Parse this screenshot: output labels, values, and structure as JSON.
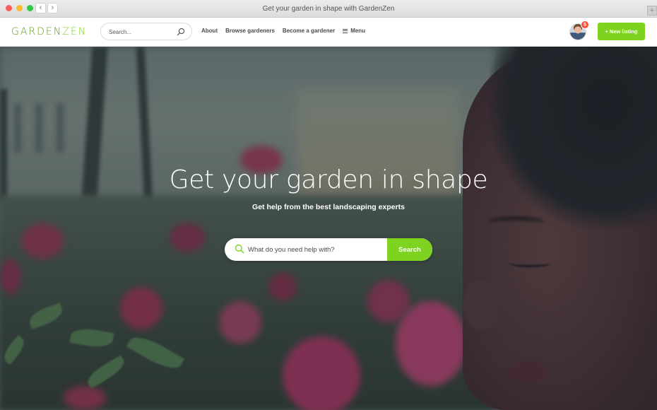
{
  "browser": {
    "title": "Get your garden in shape with GardenZen",
    "back_glyph": "‹",
    "forward_glyph": "›",
    "new_tab_glyph": "+"
  },
  "header": {
    "logo_part1": "GARDEN",
    "logo_part2": "ZEN",
    "search_placeholder": "Search...",
    "search_icon": "search-icon",
    "nav": {
      "about": "About",
      "browse": "Browse gardeners",
      "become": "Become a gardener",
      "menu": "Menu"
    },
    "notification_count": "5",
    "new_listing_label": "+ New listing"
  },
  "hero": {
    "title": "Get your garden in shape",
    "subtitle": "Get help from the best landscaping experts",
    "search_placeholder": "What do you need help with?",
    "search_button": "Search"
  },
  "colors": {
    "accent_green": "#7ed321",
    "logo_dark_green": "#5e9a1c",
    "badge_red": "#ff4b3a"
  }
}
